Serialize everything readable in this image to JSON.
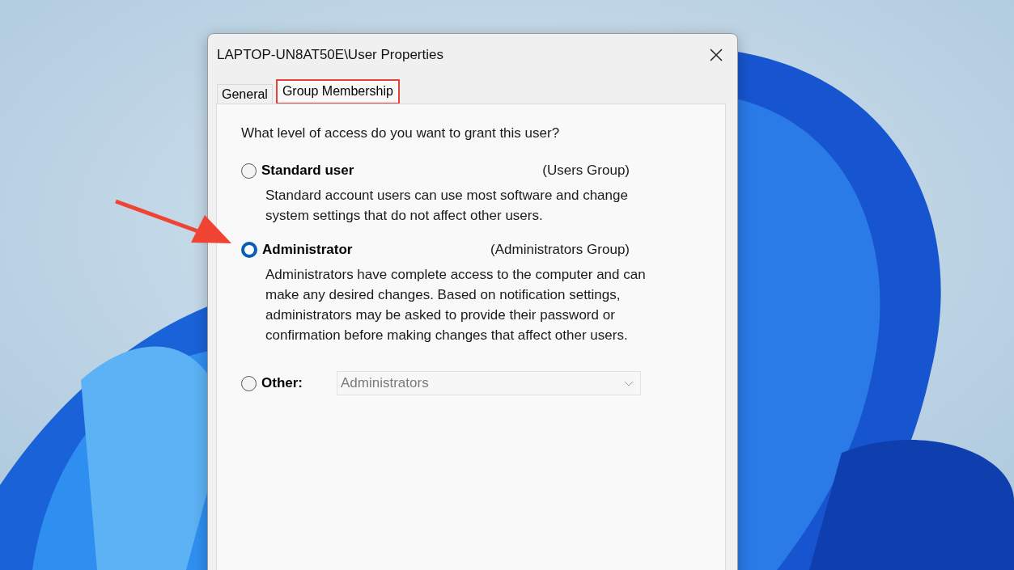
{
  "window": {
    "title": "LAPTOP-UN8AT50E\\User Properties"
  },
  "tabs": [
    {
      "label": "General",
      "selected": false,
      "highlighted": false
    },
    {
      "label": "Group Membership",
      "selected": true,
      "highlighted": true
    }
  ],
  "question": "What level of access do you want to grant this user?",
  "options": [
    {
      "kind": "described",
      "label": "Standard user",
      "group": "(Users Group)",
      "selected": false,
      "description": "Standard account users can use most software and change system settings that do not affect other users."
    },
    {
      "kind": "described",
      "label": "Administrator",
      "group": "(Administrators Group)",
      "selected": true,
      "pointed": true,
      "description": "Administrators have complete access to the computer and can make any desired changes. Based on notification settings, administrators may be asked to provide their password or confirmation before making changes that affect other users."
    },
    {
      "kind": "dropdown",
      "label": "Other:",
      "selected": false,
      "value": "Administrators",
      "disabled": true
    }
  ]
}
